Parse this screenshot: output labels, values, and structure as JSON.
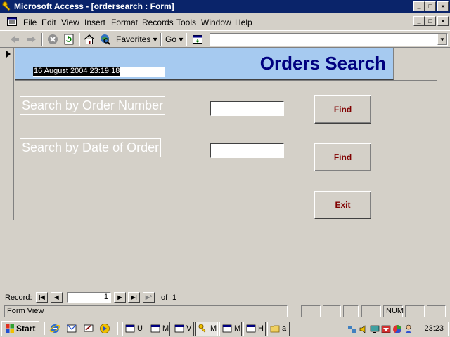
{
  "window": {
    "title": "Microsoft Access - [ordersearch : Form]",
    "controls": [
      "_",
      "□",
      "×"
    ]
  },
  "menubar": {
    "items": [
      "File",
      "Edit",
      "View",
      "Insert",
      "Format",
      "Records",
      "Tools",
      "Window",
      "Help"
    ],
    "mdi_controls": [
      "_",
      "□",
      "×"
    ]
  },
  "toolbar": {
    "favorites_label": "Favorites ▾",
    "go_label": "Go ▾",
    "address_value": ""
  },
  "form": {
    "timestamp": "16 August 2004 23:19:18",
    "heading": "Orders Search",
    "order_number_label": "Search by Order Number",
    "order_number_value": "",
    "order_date_label": "Search by Date of Order",
    "order_date_value": "",
    "find_label_1": "Find",
    "find_label_2": "Find",
    "exit_label": "Exit"
  },
  "record_nav": {
    "label": "Record:",
    "current": "1",
    "of_label": "of",
    "total": "1"
  },
  "statusbar": {
    "mode": "Form View",
    "num_indicator": "NUM"
  },
  "taskbar": {
    "start_label": "Start",
    "tasks": [
      "U",
      "M",
      "V",
      "M",
      "M",
      "H",
      "a"
    ],
    "clock": "23:23"
  },
  "colors": {
    "titlebar": "#0a246a",
    "form_header": "#a6caf0",
    "heading_text": "#000080",
    "button_text": "#800000",
    "form_background": "#d4d0c8"
  }
}
